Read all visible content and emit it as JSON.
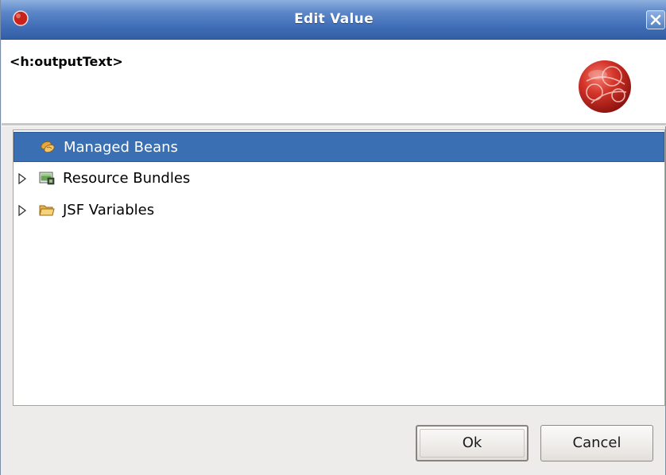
{
  "window": {
    "title": "Edit Value"
  },
  "banner": {
    "title": "<h:outputText>"
  },
  "tree": {
    "items": [
      {
        "label": "Managed Beans",
        "selected": true,
        "expandable": false,
        "icon": "beans-icon"
      },
      {
        "label": "Resource Bundles",
        "selected": false,
        "expandable": true,
        "icon": "resource-bundle-icon"
      },
      {
        "label": "JSF Variables",
        "selected": false,
        "expandable": true,
        "icon": "folder-icon"
      }
    ]
  },
  "buttons": {
    "ok_label": "Ok",
    "cancel_label": "Cancel"
  },
  "colors": {
    "titlebar": "#3f6db6",
    "selection": "#3b6fb3",
    "logo_red": "#c8231b"
  }
}
